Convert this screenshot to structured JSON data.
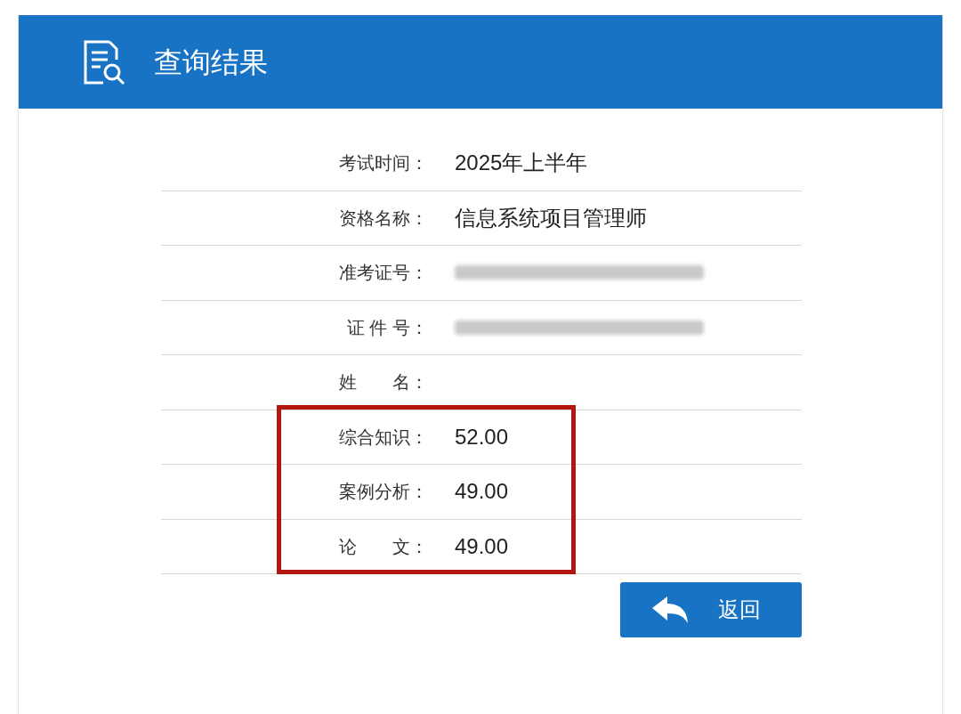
{
  "header": {
    "title": "查询结果"
  },
  "rows": [
    {
      "label": "考试时间：",
      "kind": "text",
      "value": "2025年上半年"
    },
    {
      "label": "资格名称：",
      "kind": "text",
      "value": "信息系统项目管理师"
    },
    {
      "label": "准考证号：",
      "kind": "redacted"
    },
    {
      "label": "证 件 号：",
      "kind": "redacted"
    },
    {
      "label": "姓　　名：",
      "kind": "blank"
    }
  ],
  "scores": [
    {
      "label": "综合知识：",
      "value": "52.00"
    },
    {
      "label": "案例分析：",
      "value": "49.00"
    },
    {
      "label": "论　　文：",
      "value": "49.00"
    }
  ],
  "button": {
    "label": "返回"
  }
}
